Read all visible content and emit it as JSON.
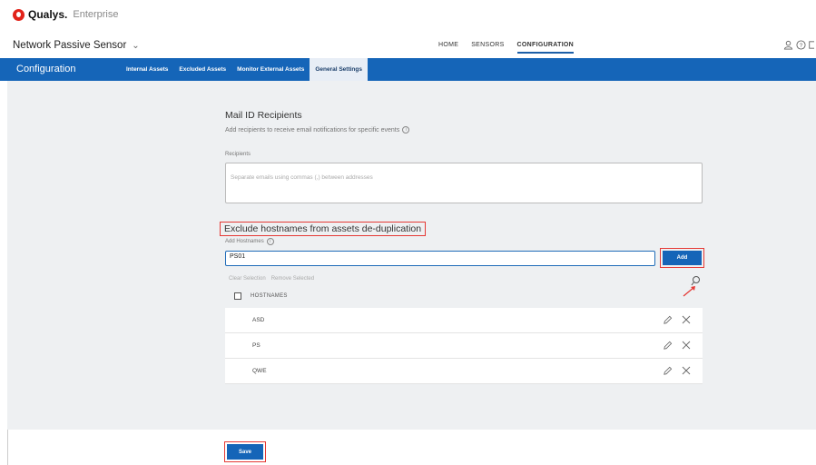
{
  "brand": {
    "name": "Qualys.",
    "edition": "Enterprise"
  },
  "app": {
    "name": "Network Passive Sensor"
  },
  "topnav": [
    "HOME",
    "SENSORS",
    "CONFIGURATION"
  ],
  "config_bar": {
    "title": "Configuration",
    "tabs": [
      "Internal Assets",
      "Excluded Assets",
      "Monitor External Assets",
      "General Settings"
    ],
    "active_tab": "General Settings"
  },
  "mail": {
    "title": "Mail ID Recipients",
    "description": "Add recipients to receive email notifications for specific events",
    "recipients_label": "Recipients",
    "recipients_placeholder": "Separate emails using commas (,) between addresses"
  },
  "exclude": {
    "title": "Exclude hostnames from assets de-duplication",
    "add_label": "Add Hostnames",
    "input_value": "PS01",
    "add_button": "Add",
    "clear_selection": "Clear Selection",
    "remove_selected": "Remove Selected",
    "column_header": "HOSTNAMES",
    "rows": [
      "ASD",
      "PS",
      "QWE"
    ]
  },
  "save_button": "Save",
  "colors": {
    "accent": "#1565b8",
    "highlight": "#e53935",
    "brand": "#e2231a"
  }
}
